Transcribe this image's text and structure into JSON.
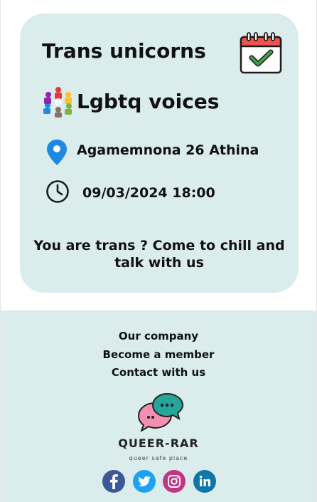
{
  "event": {
    "title": "Trans unicorns",
    "organizer": "Lgbtq voices",
    "location": "Agamemnona 26 Athina",
    "datetime": "09/03/2024 18:00",
    "description": "You are trans ? Come to chill and talk with us",
    "icons": {
      "calendar": "calendar-check-icon",
      "organizer_logo": "people-circle-logo",
      "location": "map-pin-icon",
      "time": "clock-icon"
    }
  },
  "footer": {
    "links": [
      "Our company",
      "Become a member",
      "Contact with us"
    ],
    "brand": {
      "name": "QUEER-RAR",
      "tagline": "queer safe place",
      "logo_icon": "chat-bubbles-icon"
    },
    "social": [
      {
        "name": "facebook-icon",
        "color": "#3b5998"
      },
      {
        "name": "twitter-icon",
        "color": "#1da1f2"
      },
      {
        "name": "instagram-icon",
        "color": "#c13584"
      },
      {
        "name": "linkedin-icon",
        "color": "#0e76a8"
      }
    ]
  },
  "colors": {
    "card_background": "#daecec",
    "footer_background": "#daecec",
    "text": "#111111",
    "pin_blue": "#1e88e5"
  }
}
